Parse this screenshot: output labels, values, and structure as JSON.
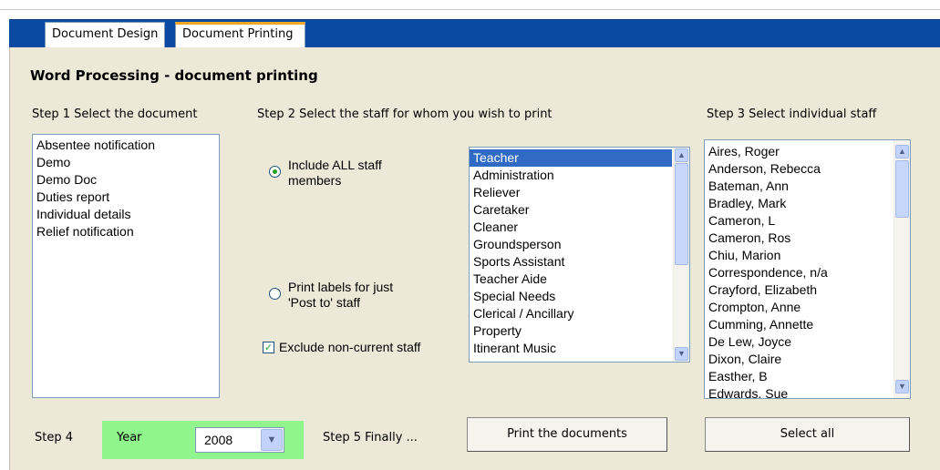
{
  "tabs": [
    {
      "label": "Document Design",
      "active": false
    },
    {
      "label": "Document Printing",
      "active": true
    }
  ],
  "page_title": "Word Processing - document printing",
  "step1": {
    "label": "Step 1   Select the document",
    "documents": [
      "Absentee notification",
      "Demo",
      "Demo Doc",
      "Duties report",
      "Individual details",
      "Relief notification"
    ]
  },
  "step2": {
    "label": "Step 2   Select the staff for whom you wish to print",
    "option_all": {
      "line1": "Include ALL staff",
      "line2": "members",
      "selected": true
    },
    "option_post": {
      "line1": "Print labels for just",
      "line2": "'Post to' staff",
      "selected": false
    },
    "exclude_noncurrent": {
      "label": "Exclude non-current staff",
      "checked": true
    },
    "categories": [
      "Teacher",
      "Administration",
      "Reliever",
      "Caretaker",
      "Cleaner",
      "Groundsperson",
      "Sports Assistant",
      "Teacher Aide",
      "Special Needs",
      "Clerical / Ancillary",
      "Property",
      "Itinerant Music"
    ],
    "selected_category": "Teacher"
  },
  "step3": {
    "label": "Step 3   Select individual staff",
    "staff": [
      "Aires, Roger",
      "Anderson, Rebecca",
      "Bateman, Ann",
      "Bradley, Mark",
      "Cameron, L",
      "Cameron, Ros",
      "Chiu, Marion",
      "Correspondence, n/a",
      "Crayford, Elizabeth",
      "Crompton, Anne",
      "Cumming, Annette",
      "De Lew, Joyce",
      "Dixon, Claire",
      "Easther, B",
      "Edwards, Sue"
    ]
  },
  "step4": {
    "label": "Step 4",
    "year_label": "Year",
    "year_value": "2008"
  },
  "step5": {
    "label": "Step 5   Finally ..."
  },
  "buttons": {
    "print": "Print the documents",
    "select_all": "Select all"
  },
  "colors": {
    "tab_strip": "#0a4aa3",
    "active_tab_accent": "#f5a623",
    "panel": "#ece9d8",
    "year_highlight": "#8ff58c",
    "selection": "#316ac5"
  }
}
